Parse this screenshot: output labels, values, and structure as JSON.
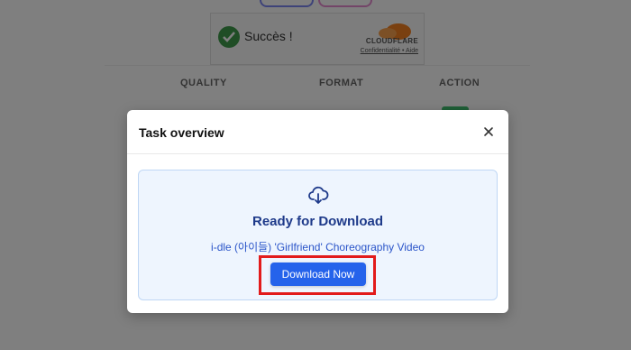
{
  "background": {
    "captcha": {
      "status_text": "Succès !",
      "provider": "CLOUDFLARE",
      "links": "Confidentialité • Aide"
    },
    "table_headers": [
      "QUALITY",
      "FORMAT",
      "ACTION"
    ]
  },
  "modal": {
    "title": "Task overview",
    "close_icon": "close-icon",
    "card": {
      "icon": "cloud-download-icon",
      "heading": "Ready for Download",
      "video_title": "i-dle (아이들) 'Girlfriend' Choreography Video",
      "button_label": "Download Now"
    }
  },
  "colors": {
    "primary": "#2563eb",
    "heading": "#1e3a8a",
    "highlight": "#e21b1b",
    "card_bg": "#eef5fe"
  }
}
